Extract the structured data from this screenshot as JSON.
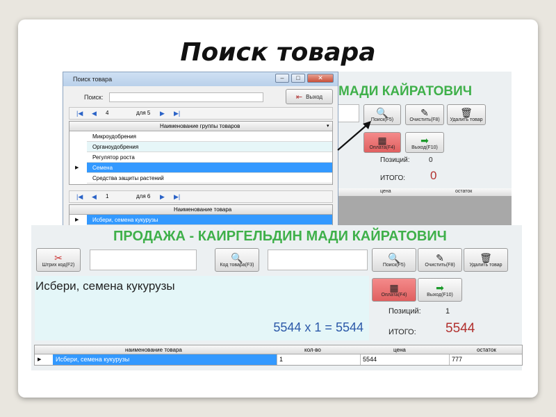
{
  "slide_title": "Поиск товара",
  "main_window_top": {
    "title_partial": "МАДИ КАЙРАТОВИЧ",
    "search_btn": "Поиск(F5)",
    "clear_btn": "Очистить(F8)",
    "delete_btn": "Удалить товар",
    "pay_btn": "Оплата(F4)",
    "exit_btn": "Выход(F10)",
    "positions_label": "Позиций:",
    "positions_value": "0",
    "total_label": "ИТОГО:",
    "total_value": "0",
    "col_price": "цена",
    "col_stock": "остаток"
  },
  "dialog": {
    "title": "Поиск товара",
    "search_label": "Поиск:",
    "search_value": "",
    "exit_btn": "Выход",
    "nav1": {
      "current": "4",
      "of_label": "для 5"
    },
    "groups_header": "Наименование группы товаров",
    "groups": [
      "Микроудобрения",
      "Органоудобрения",
      "Регулятор роста",
      "Семена",
      "Средства защиты растений"
    ],
    "selected_group_index": 3,
    "nav2": {
      "current": "1",
      "of_label": "для 6"
    },
    "products_header": "Наименование товара",
    "products": [
      "Исбери, семена кукурузы"
    ]
  },
  "main_window": {
    "title": "ПРОДАЖА - КАИРГЕЛЬДИН МАДИ КАЙРАТОВИЧ",
    "barcode_btn": "Штрих код(F2)",
    "barcode_value": "",
    "code_btn": "Код товара(F3)",
    "code_value": "",
    "search_btn": "Поиск(F5)",
    "clear_btn": "Очистить(F8)",
    "delete_btn": "Удалить товар",
    "pay_btn": "Оплата(F4)",
    "exit_btn": "Выход(F10)",
    "product_name": "Исбери, семена кукурузы",
    "calc": "5544 x 1 = 5544",
    "positions_label": "Позиций:",
    "positions_value": "1",
    "total_label": "ИТОГО:",
    "total_value": "5544",
    "table": {
      "headers": [
        "наименование товара",
        "кол-во",
        "цена",
        "остаток"
      ],
      "rows": [
        [
          "Исбери, семена кукурузы",
          "1",
          "5544",
          "777"
        ]
      ]
    }
  },
  "colors": {
    "title_green": "#3fb04a",
    "total_red": "#b1302e",
    "selection_blue": "#3399ff",
    "calc_blue": "#2b58a8"
  }
}
